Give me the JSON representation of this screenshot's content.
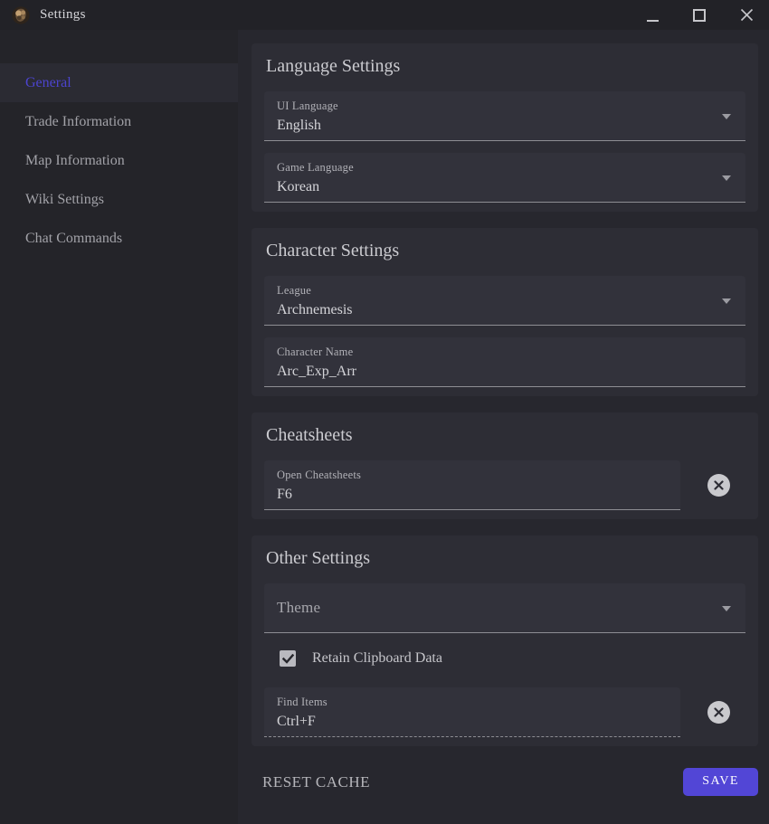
{
  "titlebar": {
    "title": "Settings"
  },
  "sidebar": {
    "items": [
      {
        "label": "General",
        "active": true
      },
      {
        "label": "Trade Information",
        "active": false
      },
      {
        "label": "Map Information",
        "active": false
      },
      {
        "label": "Wiki Settings",
        "active": false
      },
      {
        "label": "Chat Commands",
        "active": false
      }
    ]
  },
  "sections": {
    "language": {
      "title": "Language Settings",
      "ui_language": {
        "label": "UI Language",
        "value": "English"
      },
      "game_language": {
        "label": "Game Language",
        "value": "Korean"
      }
    },
    "character": {
      "title": "Character Settings",
      "league": {
        "label": "League",
        "value": "Archnemesis"
      },
      "character_name": {
        "label": "Character Name",
        "value": "Arc_Exp_Arr"
      }
    },
    "cheatsheets": {
      "title": "Cheatsheets",
      "open_cheatsheets": {
        "label": "Open Cheatsheets",
        "value": "F6"
      }
    },
    "other": {
      "title": "Other Settings",
      "theme": {
        "label": "Theme",
        "value": ""
      },
      "retain_clipboard": {
        "label": "Retain Clipboard Data",
        "checked": true
      },
      "find_items": {
        "label": "Find Items",
        "value": "Ctrl+F"
      }
    }
  },
  "footer": {
    "reset_cache_label": "RESET CACHE",
    "save_label": "SAVE"
  },
  "colors": {
    "accent": "#5246d6",
    "active_nav_text": "#4c44cf",
    "titlebar_bg": "#222227",
    "sidebar_bg": "#242429",
    "content_bg": "#27272e",
    "card_bg": "#2d2d35",
    "field_bg": "#32323b"
  }
}
